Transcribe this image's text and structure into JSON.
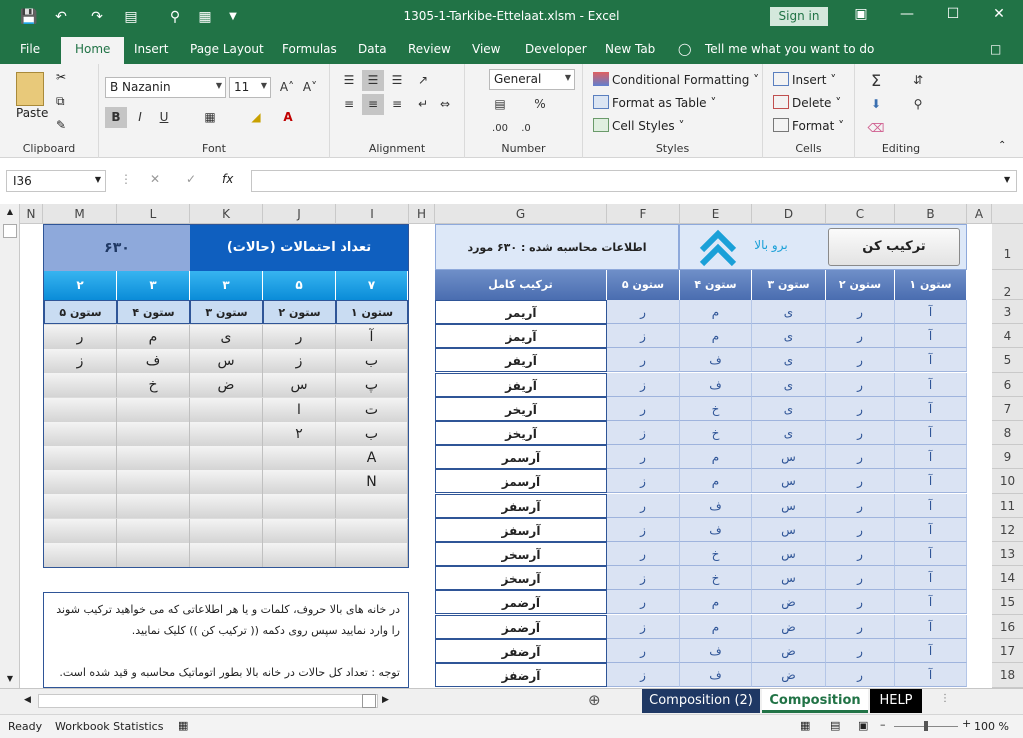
{
  "window": {
    "title": "1305-1-Tarkibe-Ettelaat.xlsm  -  Excel",
    "signin": "Sign in"
  },
  "tabs": [
    "File",
    "Home",
    "Insert",
    "Page Layout",
    "Formulas",
    "Data",
    "Review",
    "View",
    "Developer",
    "New Tab"
  ],
  "tell_me": "Tell me what you want to do",
  "ribbon": {
    "clipboard": {
      "label": "Clipboard",
      "paste": "Paste"
    },
    "font": {
      "label": "Font",
      "name": "B Nazanin",
      "size": "11",
      "bold": "B",
      "italic": "I",
      "underline": "U"
    },
    "alignment": {
      "label": "Alignment"
    },
    "number": {
      "label": "Number",
      "format": "General"
    },
    "styles": {
      "label": "Styles",
      "conditional": "Conditional Formatting",
      "table": "Format as Table",
      "cell": "Cell Styles"
    },
    "cells": {
      "label": "Cells",
      "insert": "Insert",
      "delete": "Delete",
      "format": "Format"
    },
    "editing": {
      "label": "Editing"
    }
  },
  "formula_bar": {
    "name_box": "I36",
    "formula": ""
  },
  "columns": [
    "N",
    "M",
    "L",
    "K",
    "J",
    "I",
    "H",
    "G",
    "F",
    "E",
    "D",
    "C",
    "B",
    "A"
  ],
  "rows": [
    "1",
    "2",
    "3",
    "4",
    "5",
    "6",
    "7",
    "8",
    "9",
    "10",
    "11",
    "12",
    "13",
    "14",
    "15",
    "16",
    "17",
    "18"
  ],
  "left_panel": {
    "count": "۶۳۰",
    "title": "تعداد احتمالات (حالات)",
    "per_col": [
      "۲",
      "۳",
      "۳",
      "۵",
      "۷"
    ],
    "col_headers": [
      "ستون ۵",
      "ستون ۴",
      "ستون ۳",
      "ستون ۲",
      "ستون ۱"
    ],
    "grid": [
      [
        "ر",
        "م",
        "ی",
        "ر",
        "آ"
      ],
      [
        "ز",
        "ف",
        "س",
        "ز",
        "ب"
      ],
      [
        "",
        "خ",
        "ض",
        "س",
        "پ"
      ],
      [
        "",
        "",
        "",
        "ا",
        "ت"
      ],
      [
        "",
        "",
        "",
        "۲",
        "ب"
      ],
      [
        "",
        "",
        "",
        "",
        "A"
      ],
      [
        "",
        "",
        "",
        "",
        "N"
      ],
      [
        "",
        "",
        "",
        "",
        ""
      ],
      [
        "",
        "",
        "",
        "",
        ""
      ],
      [
        "",
        "",
        "",
        "",
        ""
      ]
    ],
    "note_1": "در خانه های بالا حروف، کلمات و یا هر اطلاعاتی که می خواهید ترکیب شوند",
    "note_2": "را وارد نمایید سپس روی دکمه (( ترکیب کن )) کلیک نمایید.",
    "note_3": "توجه : تعداد کل حالات در خانه بالا بطور اتوماتیک محاسبه و قید شده است."
  },
  "right_panel": {
    "info": "اطلاعات محاسبه شده :   ۶۳۰ مورد",
    "up_label": "برو بالا",
    "combine_btn": "ترکیب کن",
    "headers": [
      "ترکیب کامل",
      "ستون ۵",
      "ستون ۴",
      "ستون ۳",
      "ستون ۲",
      "ستون ۱"
    ],
    "rows": [
      [
        "آریمر",
        "ر",
        "م",
        "ی",
        "ر",
        "آ"
      ],
      [
        "آریمز",
        "ز",
        "م",
        "ی",
        "ر",
        "آ"
      ],
      [
        "آریفر",
        "ر",
        "ف",
        "ی",
        "ر",
        "آ"
      ],
      [
        "آریفز",
        "ز",
        "ف",
        "ی",
        "ر",
        "آ"
      ],
      [
        "آریخر",
        "ر",
        "خ",
        "ی",
        "ر",
        "آ"
      ],
      [
        "آریخز",
        "ز",
        "خ",
        "ی",
        "ر",
        "آ"
      ],
      [
        "آرسمر",
        "ر",
        "م",
        "س",
        "ر",
        "آ"
      ],
      [
        "آرسمز",
        "ز",
        "م",
        "س",
        "ر",
        "آ"
      ],
      [
        "آرسفر",
        "ر",
        "ف",
        "س",
        "ر",
        "آ"
      ],
      [
        "آرسفز",
        "ز",
        "ف",
        "س",
        "ر",
        "آ"
      ],
      [
        "آرسخر",
        "ر",
        "خ",
        "س",
        "ر",
        "آ"
      ],
      [
        "آرسخز",
        "ز",
        "خ",
        "س",
        "ر",
        "آ"
      ],
      [
        "آرضمر",
        "ر",
        "م",
        "ض",
        "ر",
        "آ"
      ],
      [
        "آرضمز",
        "ز",
        "م",
        "ض",
        "ر",
        "آ"
      ],
      [
        "آرضفر",
        "ر",
        "ف",
        "ض",
        "ر",
        "آ"
      ],
      [
        "آرضفز",
        "ز",
        "ف",
        "ض",
        "ر",
        "آ"
      ]
    ]
  },
  "sheet_tabs": [
    "Composition (2)",
    "Composition",
    "HELP"
  ],
  "status": {
    "ready": "Ready",
    "stats": "Workbook Statistics",
    "zoom": "100 %"
  }
}
